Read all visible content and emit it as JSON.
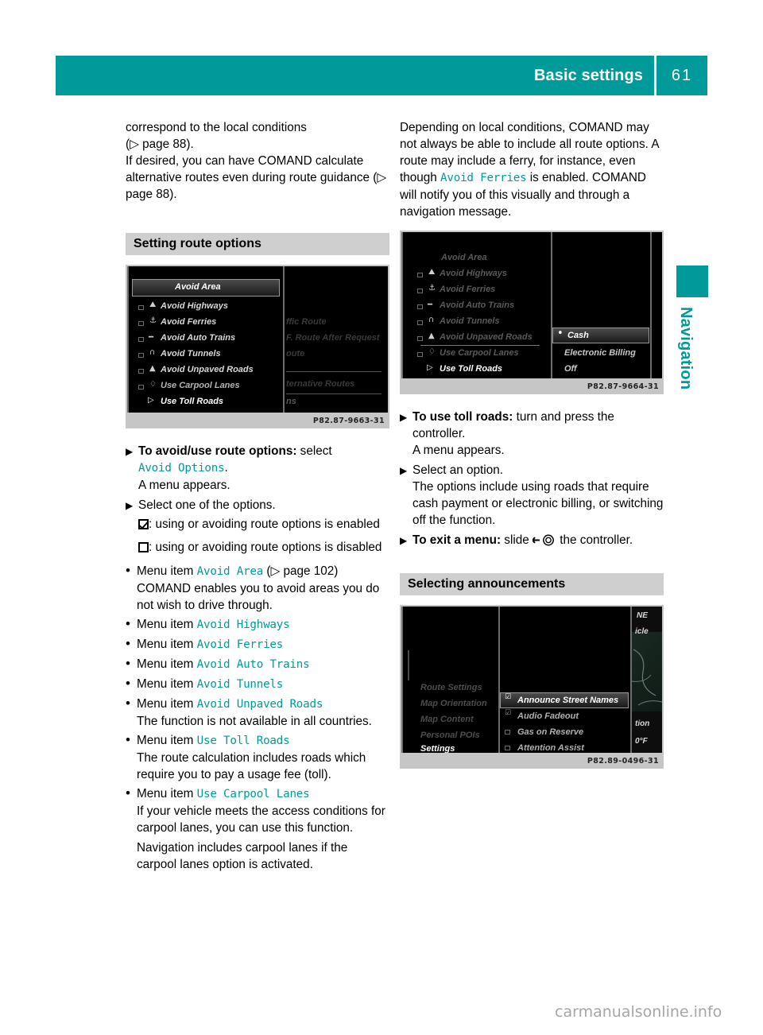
{
  "header": {
    "title": "Basic settings",
    "page_number": "61",
    "accent_color": "#009a9a"
  },
  "side_tab": {
    "label": "Navigation"
  },
  "watermark": {
    "text": "carmanualsonline.info"
  },
  "left_column": {
    "intro_paragraphs": [
      "correspond to the local conditions",
      "(▷ page 88).",
      "If desired, you can have COMAND calculate alternative routes even during route guidance (▷ page 88)."
    ],
    "section_heading": "Setting route options",
    "screenshot": {
      "caption": "P82.87-9663-31",
      "highlight_item": "Avoid Area",
      "list_items": [
        "Avoid Highways",
        "Avoid Ferries",
        "Avoid Auto Trains",
        "Avoid Tunnels",
        "Avoid Unpaved Roads",
        "Use Carpool Lanes",
        "Use Toll Roads"
      ],
      "right_panel_items": [
        "ffic Route",
        "F. Route After Request",
        "oute",
        "ternative Routes",
        "ns"
      ]
    },
    "steps": [
      {
        "bold": "To avoid/use route options:",
        "rest_before": " select ",
        "mono": "Avoid Options",
        "rest_after": ".",
        "sub": "A menu appears."
      },
      {
        "bold": "",
        "rest_before": "Select one of the options.",
        "mono": "",
        "rest_after": "",
        "sub": ""
      }
    ],
    "checkbox_enabled": ": using or avoiding route options is enabled",
    "checkbox_disabled": ": using or avoiding route options is disabled",
    "menu_items": [
      {
        "prefix": "Menu item ",
        "mono": "Avoid Area",
        "suffix": " (▷ page 102)",
        "note": "COMAND enables you to avoid areas you do not wish to drive through."
      },
      {
        "prefix": "Menu item ",
        "mono": "Avoid Highways",
        "suffix": "",
        "note": ""
      },
      {
        "prefix": "Menu item ",
        "mono": "Avoid Ferries",
        "suffix": "",
        "note": ""
      },
      {
        "prefix": "Menu item ",
        "mono": "Avoid Auto Trains",
        "suffix": "",
        "note": ""
      },
      {
        "prefix": "Menu item ",
        "mono": "Avoid Tunnels",
        "suffix": "",
        "note": ""
      },
      {
        "prefix": "Menu item ",
        "mono": "Avoid Unpaved Roads",
        "suffix": "",
        "note": "The function is not available in all countries."
      },
      {
        "prefix": "Menu item ",
        "mono": "Use Toll Roads",
        "suffix": "",
        "note": "The route calculation includes roads which require you to pay a usage fee (toll)."
      },
      {
        "prefix": "Menu item ",
        "mono": "Use Carpool Lanes",
        "suffix": "",
        "note": "If your vehicle meets the access conditions for carpool lanes, you can use this function."
      }
    ],
    "closing_paragraph": "Navigation includes carpool lanes if the carpool lanes option is activated."
  },
  "right_column": {
    "intro_before": "Depending on local conditions, COMAND may not always be able to include all route options. A route may include a ferry, for instance, even though ",
    "intro_mono": "Avoid Ferries",
    "intro_after": " is enabled. COMAND will notify you of this visually and through a navigation message.",
    "screenshot": {
      "caption": "P82.87-9664-31",
      "dim_item": "Avoid Area",
      "list_items": [
        "Avoid Highways",
        "Avoid Ferries",
        "Avoid Auto Trains",
        "Avoid Tunnels",
        "Avoid Unpaved Roads",
        "Use Carpool Lanes",
        "Use Toll Roads"
      ],
      "popup_items": [
        "Cash",
        "Electronic Billing",
        "Off"
      ],
      "popup_selected": "Cash"
    },
    "steps": [
      {
        "bold": "To use toll roads:",
        "rest": " turn and press the controller.",
        "sub": "A menu appears."
      },
      {
        "bold": "",
        "rest": "Select an option.",
        "sub": "The options include using roads that require cash payment or electronic billing, or switching off the function."
      }
    ],
    "exit_step": {
      "bold": "To exit a menu:",
      "mid": " slide ",
      "after": " the controller."
    },
    "section_heading": "Selecting announcements",
    "announce_screenshot": {
      "caption": "P82.89-0496-31",
      "left_menu": [
        "Route Settings",
        "Map Orientation",
        "Map Content",
        "Personal POIs",
        "Settings"
      ],
      "center_items": [
        {
          "label": "Announce Street Names",
          "checked": true,
          "selected": true
        },
        {
          "label": "Audio Fadeout",
          "checked": true,
          "selected": false
        },
        {
          "label": "Gas on Reserve",
          "checked": false,
          "selected": false
        },
        {
          "label": "Attention Assist",
          "checked": false,
          "selected": false
        }
      ],
      "right_edge": [
        "NE",
        "icle",
        "tion",
        "0°F"
      ]
    }
  }
}
